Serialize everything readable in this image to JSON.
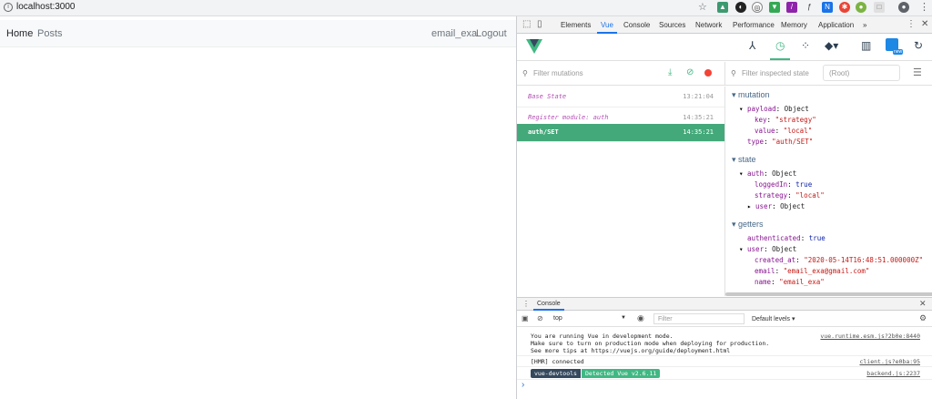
{
  "browser": {
    "url": "localhost:3000"
  },
  "app": {
    "nav": {
      "home": "Home",
      "posts": "Posts",
      "user": "email_exa",
      "logout": "Logout"
    }
  },
  "devtools": {
    "tabs": [
      "Elements",
      "Vue",
      "Console",
      "Sources",
      "Network",
      "Performance",
      "Memory",
      "Application",
      "»"
    ],
    "active_tab": "Vue",
    "vuex": {
      "filter_mutations_placeholder": "Filter mutations",
      "filter_state_placeholder": "Filter inspected state",
      "root_label": "(Root)",
      "mutations": [
        {
          "name": "Base State",
          "time": "13:21:04",
          "active": false
        },
        {
          "name": "Register module: auth",
          "time": "14:35:21",
          "active": false
        },
        {
          "name": "auth/SET",
          "time": "14:35:21",
          "active": true
        }
      ],
      "inspector": {
        "mutation_title": "mutation",
        "payload_label": "payload",
        "payload_type": "Object",
        "payload_key_k": "key",
        "payload_key_v": "\"strategy\"",
        "payload_value_k": "value",
        "payload_value_v": "\"local\"",
        "type_k": "type",
        "type_v": "\"auth/SET\"",
        "state_title": "state",
        "auth_label": "auth",
        "auth_type": "Object",
        "loggedin_k": "loggedIn",
        "loggedin_v": "true",
        "strategy_k": "strategy",
        "strategy_v": "\"local\"",
        "user_k": "user",
        "user_type": "Object",
        "getters_title": "getters",
        "authenticated_k": "authenticated",
        "authenticated_v": "true",
        "g_user_k": "user",
        "g_user_type": "Object",
        "created_k": "created_at",
        "created_v": "\"2020-05-14T16:48:51.000000Z\"",
        "email_k": "email",
        "email_v": "\"email_exa@gmail.com\"",
        "name_k": "name",
        "name_v": "\"email_exa\""
      }
    },
    "console": {
      "tab_label": "Console",
      "context": "top",
      "filter_placeholder": "Filter",
      "levels": "Default levels ▾",
      "messages": [
        {
          "text": "You are running Vue in development mode.",
          "source": "vue.runtime.esm.js?2b0e:8440"
        },
        {
          "text": "Make sure to turn on production mode when deploying for production.",
          "source": ""
        },
        {
          "text": "See more tips at https://vuejs.org/guide/deployment.html",
          "source": ""
        },
        {
          "text": "[HMR] connected",
          "source": "client.js?e0ba:95"
        }
      ],
      "badge_devtools": "vue-devtools",
      "badge_detected": "Detected Vue v2.6.11",
      "badge_source": "backend.js:2237",
      "prompt": "›"
    }
  },
  "colors": {
    "vue_green": "#44a97a",
    "accent_blue": "#1a73e8"
  }
}
